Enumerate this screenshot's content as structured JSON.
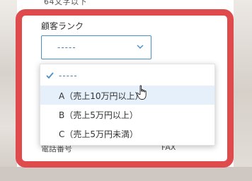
{
  "form": {
    "top_note": "64文字以下",
    "customer_rank_label": "顧客ランク",
    "phone_label": "電話番号",
    "fax_label": "FAX"
  },
  "select": {
    "current_value": "-----",
    "options": [
      {
        "label": "-----",
        "selected": true
      },
      {
        "label": "A（売上10万円以上）",
        "hovered": true
      },
      {
        "label": "B（売上5万円以上）"
      },
      {
        "label": "C（売上5万円未満）"
      }
    ]
  },
  "colors": {
    "highlight_frame": "#df4a4d",
    "accent": "#4a90c8",
    "hover_bg": "#e6f0fa"
  },
  "icons": {
    "chevron": "chevron-down-icon",
    "check": "check-icon",
    "cursor": "hand-pointer-icon"
  }
}
